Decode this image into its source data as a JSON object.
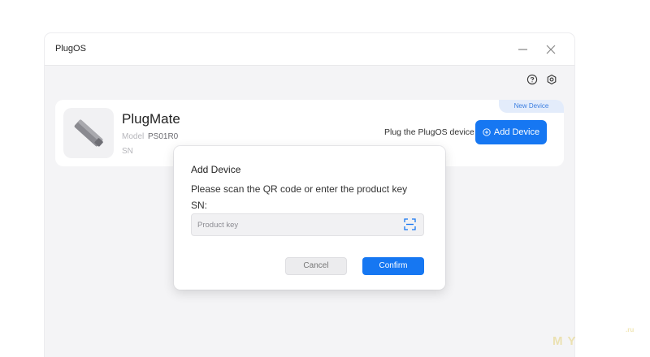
{
  "window": {
    "title": "PlugOS"
  },
  "device": {
    "name": "PlugMate",
    "model_label": "Model",
    "model_value": "PS01R0",
    "sn_label": "SN",
    "badge": "New Device",
    "plug_text": "Plug the PlugOS device",
    "add_button_label": "Add Device"
  },
  "dialog": {
    "title": "Add Device",
    "description": "Please scan the QR code or enter the product key",
    "sn_label": "SN:",
    "input_value": "",
    "input_placeholder": "Product key",
    "cancel_label": "Cancel",
    "confirm_label": "Confirm"
  },
  "watermark": {
    "main": "MY",
    "suffix": ".ru"
  },
  "colors": {
    "accent": "#1677f2",
    "badge_bg": "#e3ecfb",
    "window_bg": "#f4f4f6"
  }
}
